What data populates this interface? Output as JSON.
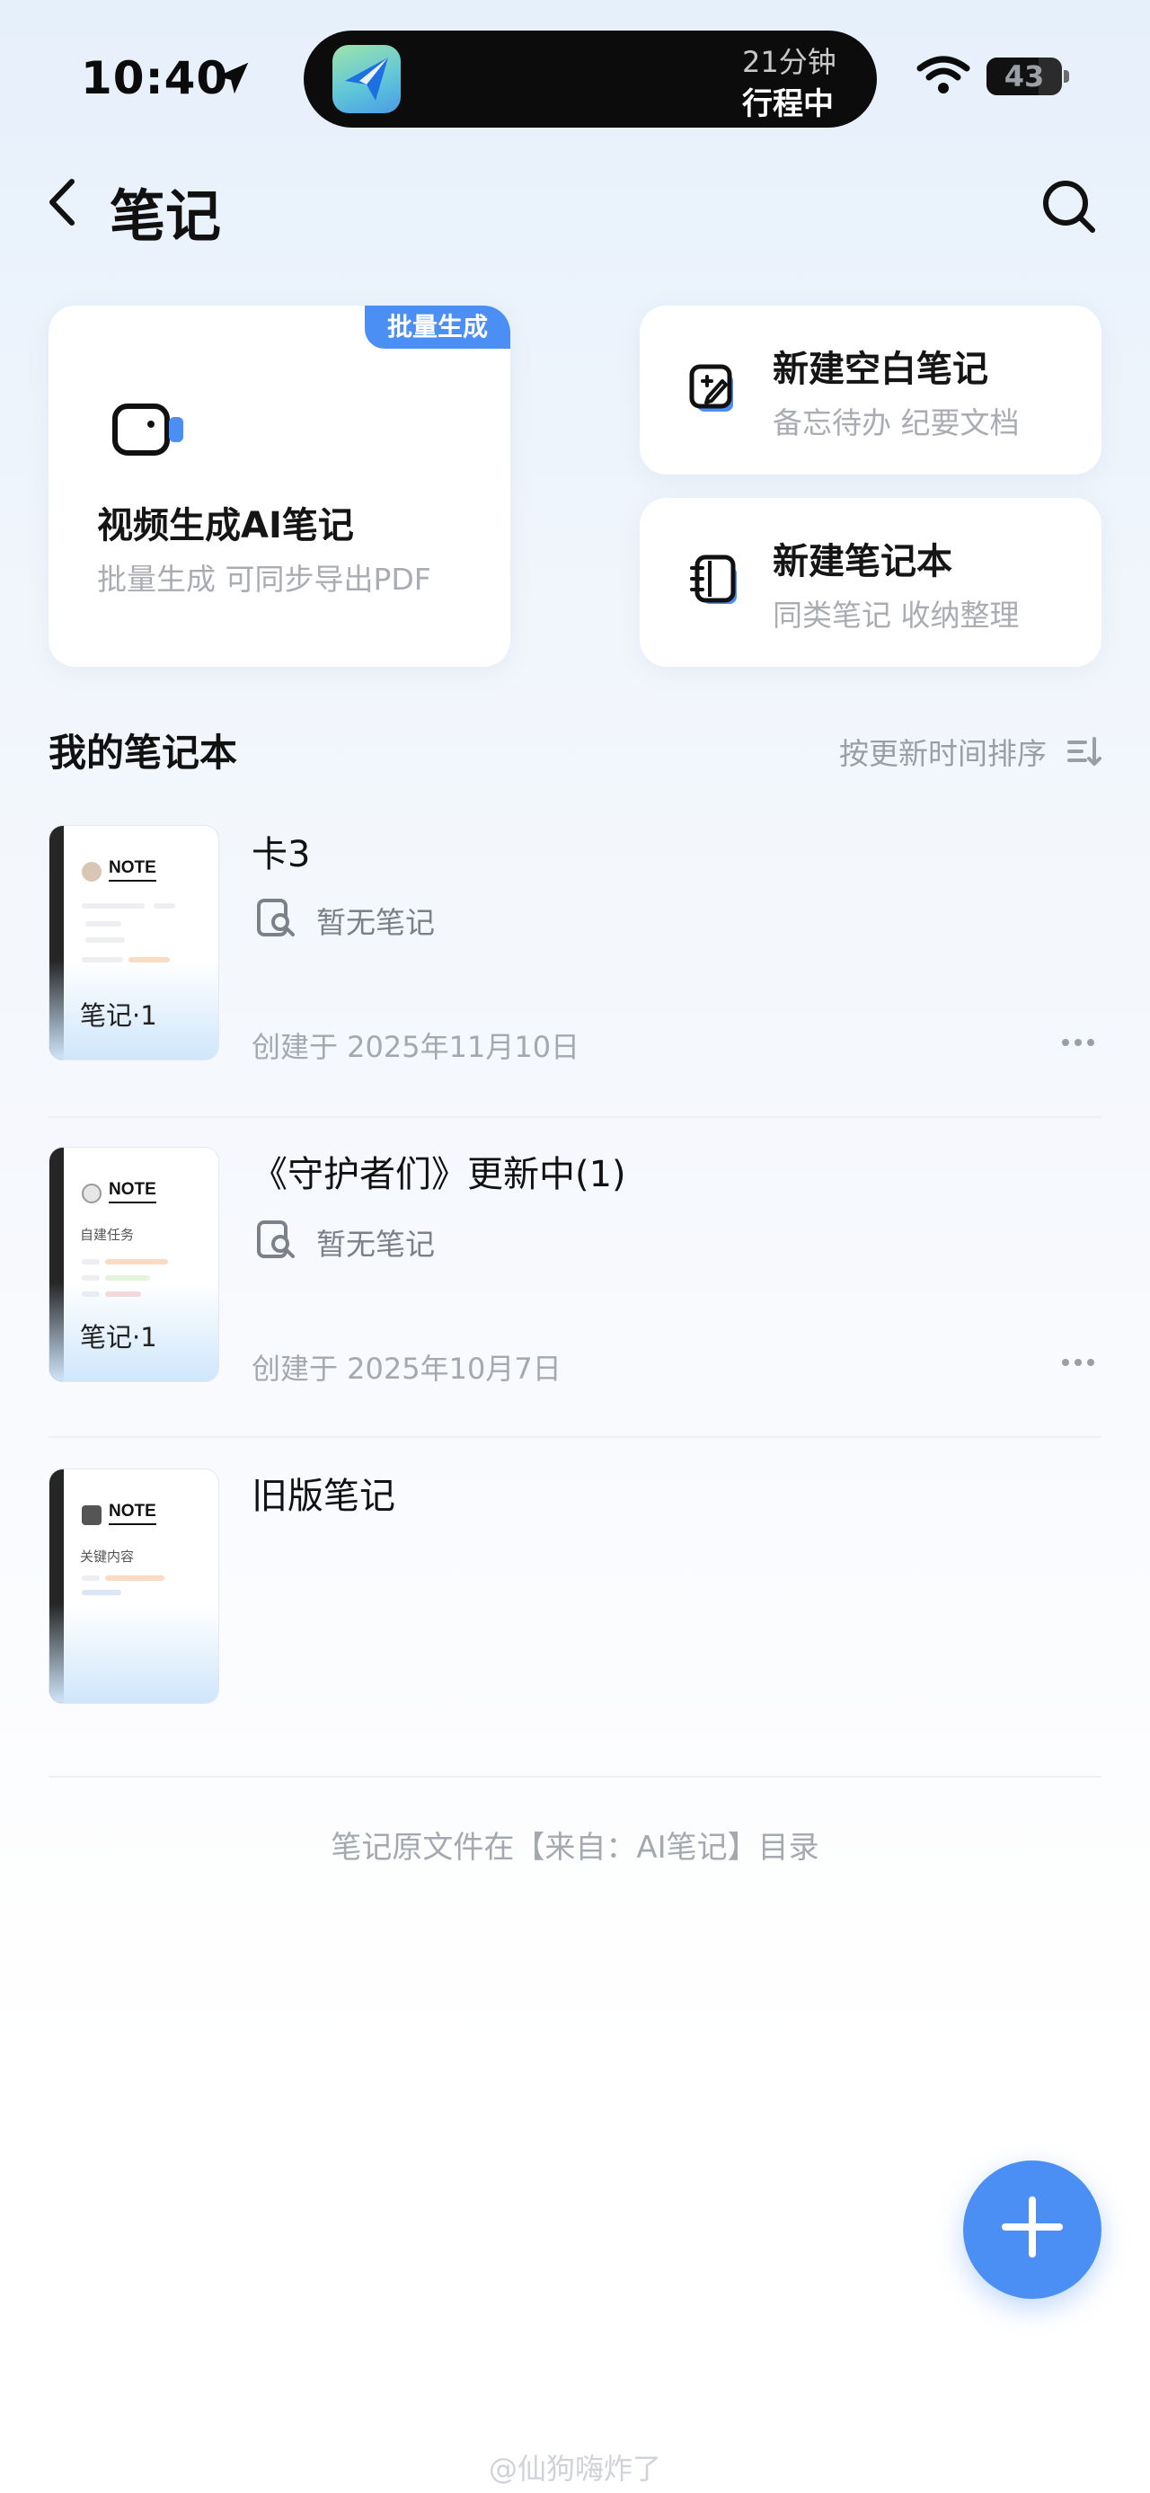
{
  "status_bar": {
    "time": "10:40",
    "island_line1": "21分钟",
    "island_line2": "行程中",
    "battery": "43"
  },
  "header": {
    "title": "笔记"
  },
  "cards": {
    "video": {
      "badge": "批量生成",
      "title": "视频生成AI笔记",
      "subtitle": "批量生成 可同步导出PDF"
    },
    "blank_note": {
      "title": "新建空白笔记",
      "subtitle": "备忘待办 纪要文档"
    },
    "notebook": {
      "title": "新建笔记本",
      "subtitle": "同类笔记 收纳整理"
    }
  },
  "section": {
    "title": "我的笔记本",
    "sort_label": "按更新时间排序"
  },
  "notebooks": [
    {
      "title": "卡3",
      "empty_text": "暂无笔记",
      "created": "创建于 2025年11月10日",
      "thumb_label": "NOTE",
      "thumb_count": "笔记·1"
    },
    {
      "title": "《守护者们》更新中(1)",
      "empty_text": "暂无笔记",
      "created": "创建于 2025年10月7日",
      "thumb_label": "NOTE",
      "thumb_sub": "自建任务",
      "thumb_count": "笔记·1"
    },
    {
      "title": "旧版笔记",
      "thumb_label": "NOTE",
      "thumb_sub": "关键内容"
    }
  ],
  "footer_note": "笔记原文件在【来自：AI笔记】目录",
  "watermark": "@仙狗嗨炸了",
  "colors": {
    "accent": "#4b8ff4",
    "muted_text": "#a9acb2"
  }
}
